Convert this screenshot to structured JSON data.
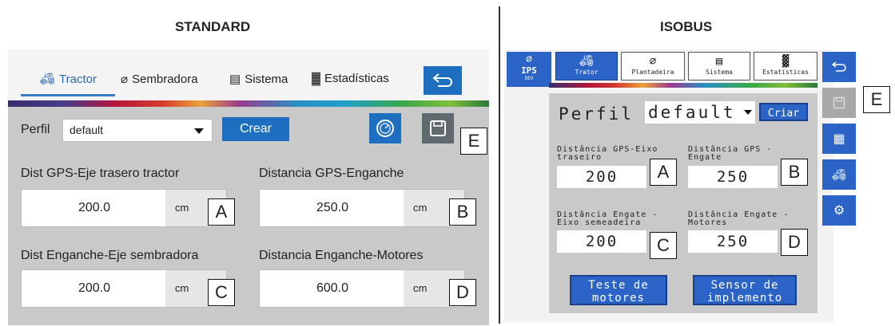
{
  "headings": {
    "standard": "STANDARD",
    "isobus": "ISOBUS"
  },
  "standard": {
    "tabs": [
      {
        "label": "Tractor",
        "icon": "tractor-icon",
        "active": true
      },
      {
        "label": "Sembradora",
        "icon": "planter-icon",
        "active": false
      },
      {
        "label": "Sistema",
        "icon": "system-icon",
        "active": false
      },
      {
        "label": "Estadísticas",
        "icon": "statistics-icon",
        "active": false
      }
    ],
    "perfil_label": "Perfil",
    "perfil_value": "default",
    "crear_label": "Crear",
    "fields": [
      {
        "label": "Dist GPS-Eje trasero tractor",
        "value": "200.0",
        "unit": "cm",
        "callout": "A"
      },
      {
        "label": "Distancia GPS-Enganche",
        "value": "250.0",
        "unit": "cm",
        "callout": "B"
      },
      {
        "label": "Dist Enganche-Eje sembradora",
        "value": "200.0",
        "unit": "cm",
        "callout": "C"
      },
      {
        "label": "Distancia Enganche-Motores",
        "value": "600.0",
        "unit": "cm",
        "callout": "D"
      }
    ],
    "save_callout": "E"
  },
  "isobus": {
    "ips_label": "IPS",
    "ips_sub": "DEV",
    "tabs": [
      {
        "label": "Trator",
        "active": true
      },
      {
        "label": "Plantadeira",
        "active": false
      },
      {
        "label": "Sistema",
        "active": false
      },
      {
        "label": "Estatísticas",
        "active": false
      }
    ],
    "perfil_label": "Perfil",
    "perfil_value": "default",
    "criar_label": "Criar",
    "fields": [
      {
        "label_line1": "Distância GPS-Eixo",
        "label_line2": "traseiro",
        "value": "200",
        "callout": "A"
      },
      {
        "label_line1": "Distância GPS -",
        "label_line2": "Engate",
        "value": "250",
        "callout": "B"
      },
      {
        "label_line1": "Distância Engate -",
        "label_line2": "Eixo semeadeira",
        "value": "200",
        "callout": "C"
      },
      {
        "label_line1": "Distância Engate -",
        "label_line2": "Motores",
        "value": "250",
        "callout": "D"
      }
    ],
    "buttons": [
      {
        "line1": "Teste de",
        "line2": "motores"
      },
      {
        "line1": "Sensor de",
        "line2": "implemento"
      }
    ],
    "save_callout": "E"
  },
  "colors": {
    "accent_blue": "#1f6fc0",
    "isobus_blue": "#2b63c6",
    "panel_gray": "#c9c9c9"
  }
}
